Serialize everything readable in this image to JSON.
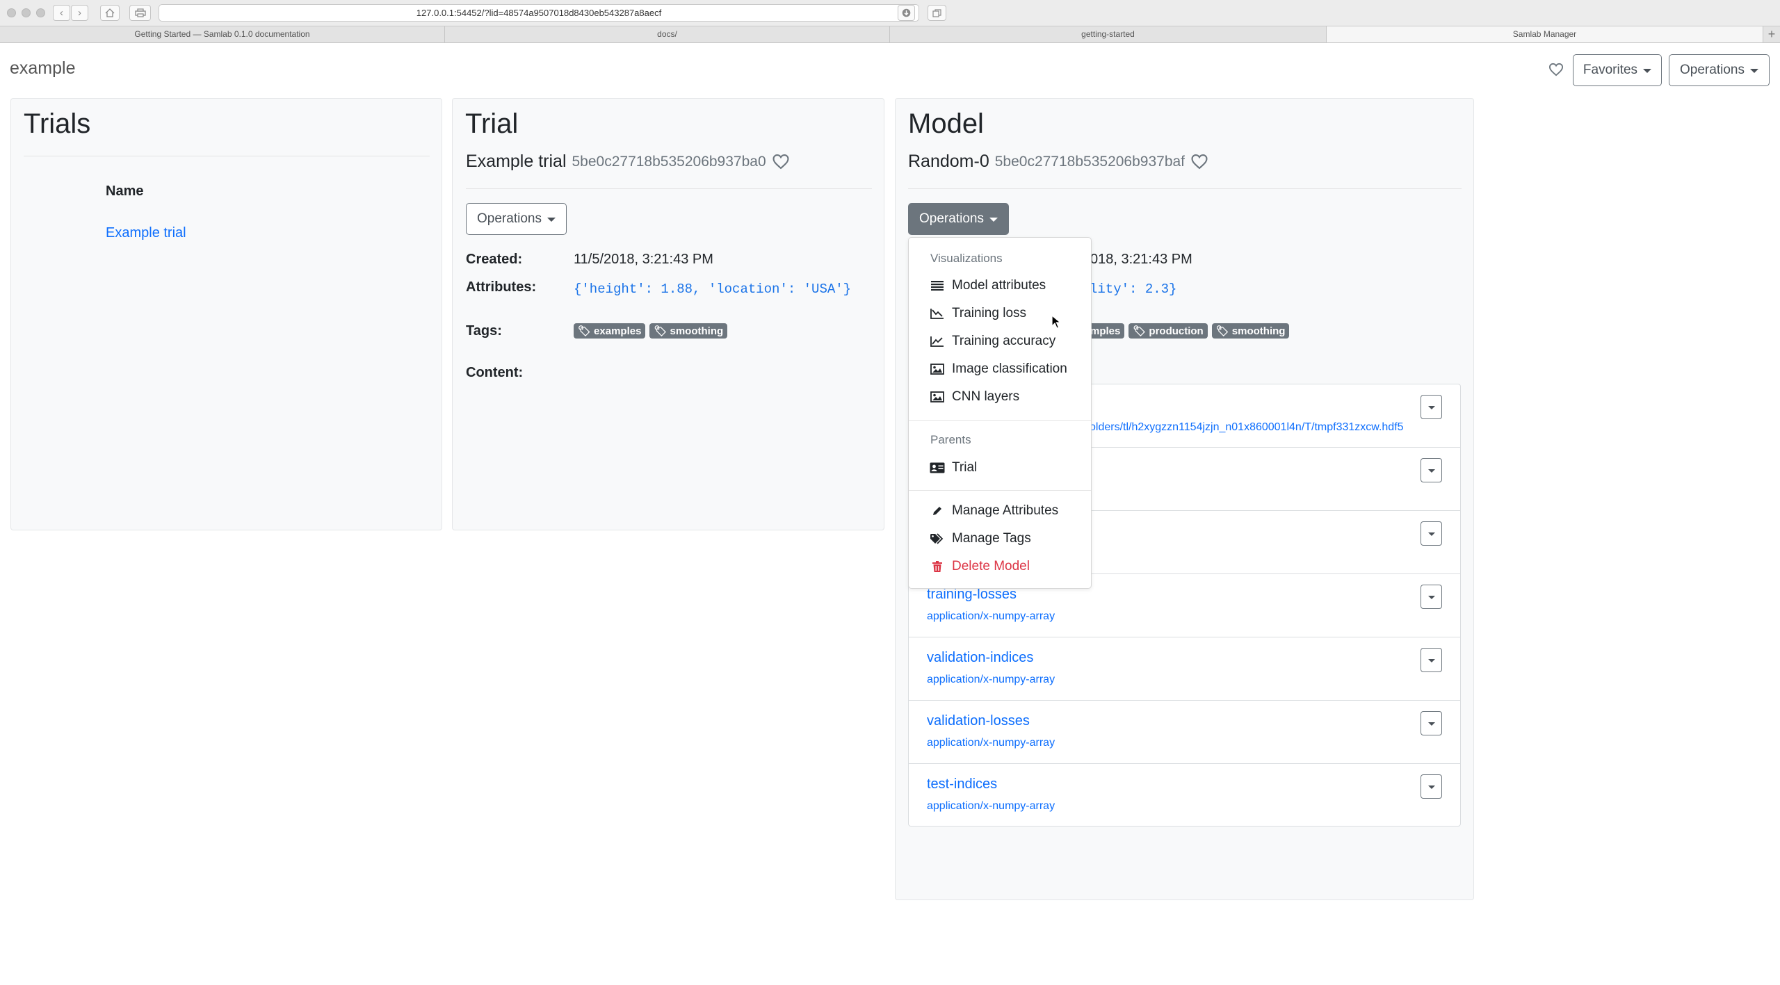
{
  "browser": {
    "url": "127.0.0.1:54452/?lid=48574a9507018d8430eb543287a8aecf",
    "tabs": [
      {
        "label": "Getting Started — Samlab 0.1.0 documentation",
        "active": false
      },
      {
        "label": "docs/",
        "active": false
      },
      {
        "label": "getting-started",
        "active": false
      },
      {
        "label": "Samlab Manager",
        "active": true
      }
    ]
  },
  "header": {
    "title": "example",
    "favorites_label": "Favorites",
    "operations_label": "Operations"
  },
  "trials_panel": {
    "title": "Trials",
    "column_header": "Name",
    "rows": [
      "Example trial"
    ]
  },
  "trial_panel": {
    "title": "Trial",
    "name": "Example trial",
    "id": "5be0c27718b535206b937ba0",
    "operations_label": "Operations",
    "created_label": "Created:",
    "created_value": "11/5/2018, 3:21:43 PM",
    "attributes_label": "Attributes:",
    "attributes_value": "{'height': 1.88, 'location': 'USA'}",
    "tags_label": "Tags:",
    "tags": [
      "examples",
      "smoothing"
    ],
    "content_label": "Content:"
  },
  "model_panel": {
    "title": "Model",
    "name": "Random-0",
    "id": "5be0c27718b535206b937baf",
    "operations_label": "Operations",
    "created_value_partial": "018, 3:21:43 PM",
    "attributes_value_partial": "lity': 2.3}",
    "tags_partial": [
      "mples",
      "production",
      "smoothing"
    ],
    "first_file_path_partial": "olders/tl/h2xygzzn1154jzjn_n01x860001l4n/T/tmpf331zxcw.hdf5",
    "files": [
      {
        "name": "",
        "type": ""
      },
      {
        "name": "",
        "type": ""
      },
      {
        "name": "",
        "type": ""
      },
      {
        "name": "training-losses",
        "type": "application/x-numpy-array"
      },
      {
        "name": "validation-indices",
        "type": "application/x-numpy-array"
      },
      {
        "name": "validation-losses",
        "type": "application/x-numpy-array"
      },
      {
        "name": "test-indices",
        "type": "application/x-numpy-array"
      }
    ]
  },
  "dropdown": {
    "visualizations_header": "Visualizations",
    "visualizations": [
      {
        "label": "Model attributes",
        "icon": "list-icon"
      },
      {
        "label": "Training loss",
        "icon": "chart-line-down-icon"
      },
      {
        "label": "Training accuracy",
        "icon": "chart-line-up-icon"
      },
      {
        "label": "Image classification",
        "icon": "image-icon"
      },
      {
        "label": "CNN layers",
        "icon": "image-icon"
      }
    ],
    "parents_header": "Parents",
    "parents": [
      {
        "label": "Trial",
        "icon": "id-card-icon"
      }
    ],
    "actions": [
      {
        "label": "Manage Attributes",
        "icon": "pencil-icon"
      },
      {
        "label": "Manage Tags",
        "icon": "tags-icon"
      },
      {
        "label": "Delete Model",
        "icon": "trash-icon"
      }
    ]
  },
  "colors": {
    "link": "#0d6efd",
    "secondary": "#6c757d",
    "danger": "#dc3545",
    "card_bg": "#f8f9fa"
  }
}
